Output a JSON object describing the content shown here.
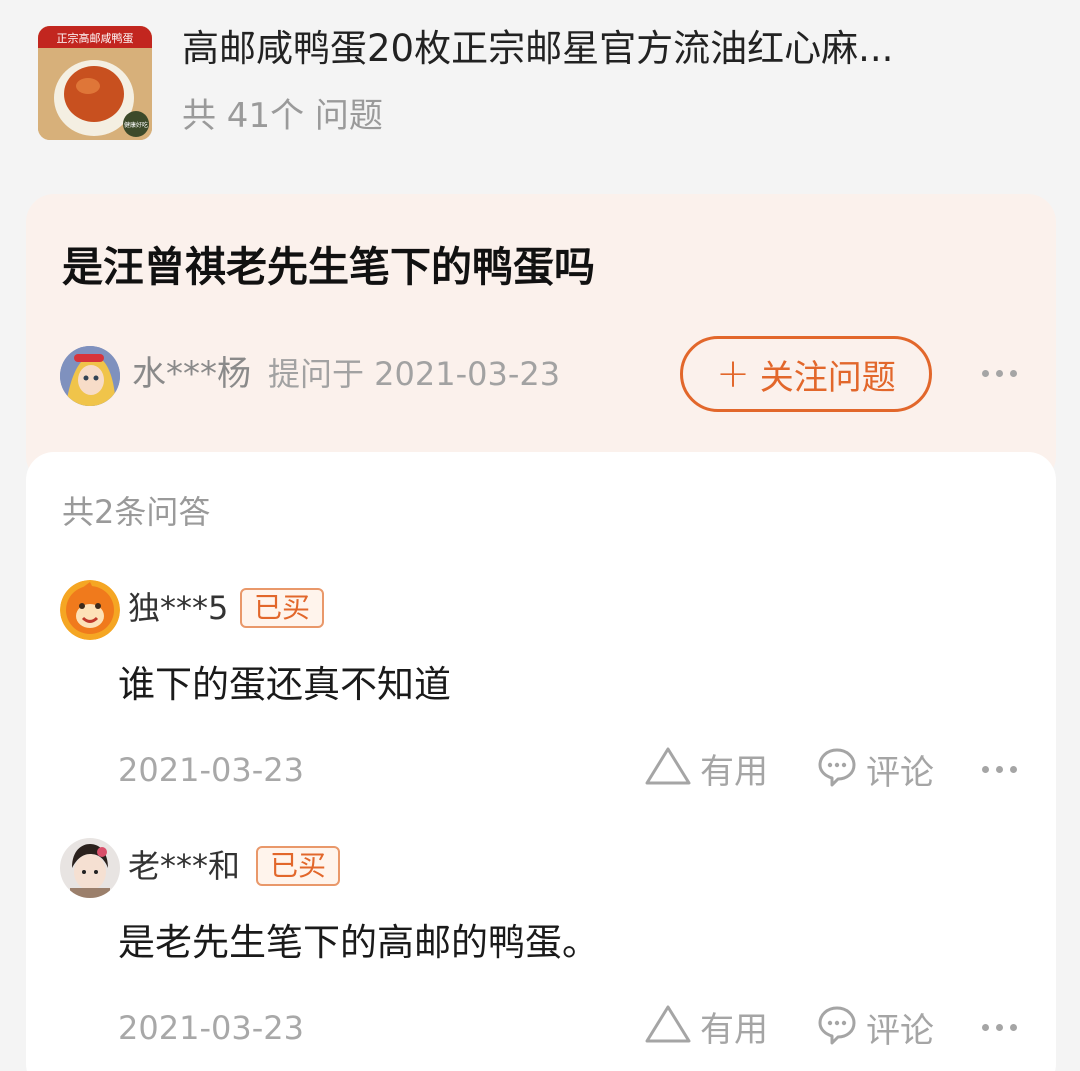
{
  "product": {
    "title": "高邮咸鸭蛋20枚正宗邮星官方流油红心麻...",
    "question_count": "共 41个 问题",
    "thumb_banner": "正宗高邮咸鸭蛋",
    "thumb_badge": "健康好吃"
  },
  "question": {
    "text": "是汪曾祺老先生笔下的鸭蛋吗",
    "asker": "水***杨",
    "asked_on": "提问于 2021-03-23",
    "follow_label": "关注问题",
    "follow_icon": "+"
  },
  "answers_panel": {
    "count_label": "共2条问答",
    "useful_label": "有用",
    "comment_label": "评论",
    "items": [
      {
        "user": "独***5",
        "badge": "已买",
        "text": "谁下的蛋还真不知道",
        "date": "2021-03-23"
      },
      {
        "user": "老***和",
        "badge": "已买",
        "text": "是老先生笔下的高邮的鸭蛋。",
        "date": "2021-03-23"
      }
    ]
  },
  "colors": {
    "accent": "#e2672b",
    "question_bg": "#fbf1ec",
    "page_bg": "#f4f4f4",
    "muted_text": "#9a9a9a"
  },
  "icons": [
    "more-icon",
    "plus-icon",
    "thumbs-up-triangle-icon",
    "comment-bubble-icon"
  ]
}
